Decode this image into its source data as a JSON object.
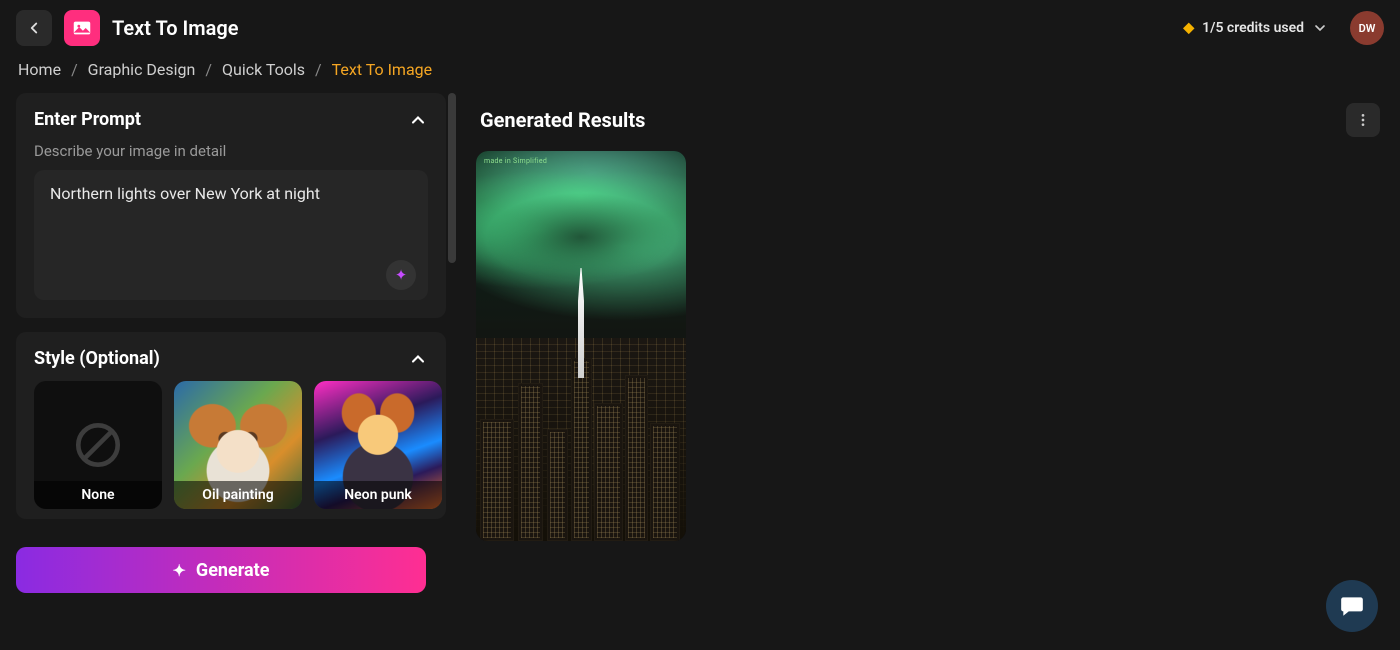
{
  "header": {
    "title": "Text To Image",
    "credits_label": "1/5 credits used",
    "avatar_initials": "DW"
  },
  "breadcrumb": {
    "items": [
      "Home",
      "Graphic Design",
      "Quick Tools",
      "Text To Image"
    ],
    "active_index": 3
  },
  "prompt_panel": {
    "heading": "Enter Prompt",
    "subtext": "Describe your image in detail",
    "value": "Northern lights over New York at night"
  },
  "style_panel": {
    "heading": "Style (Optional)",
    "options": [
      {
        "label": "None"
      },
      {
        "label": "Oil painting"
      },
      {
        "label": "Neon punk"
      }
    ]
  },
  "generate_label": "Generate",
  "results": {
    "heading": "Generated Results",
    "watermark": "made in Simplified"
  }
}
